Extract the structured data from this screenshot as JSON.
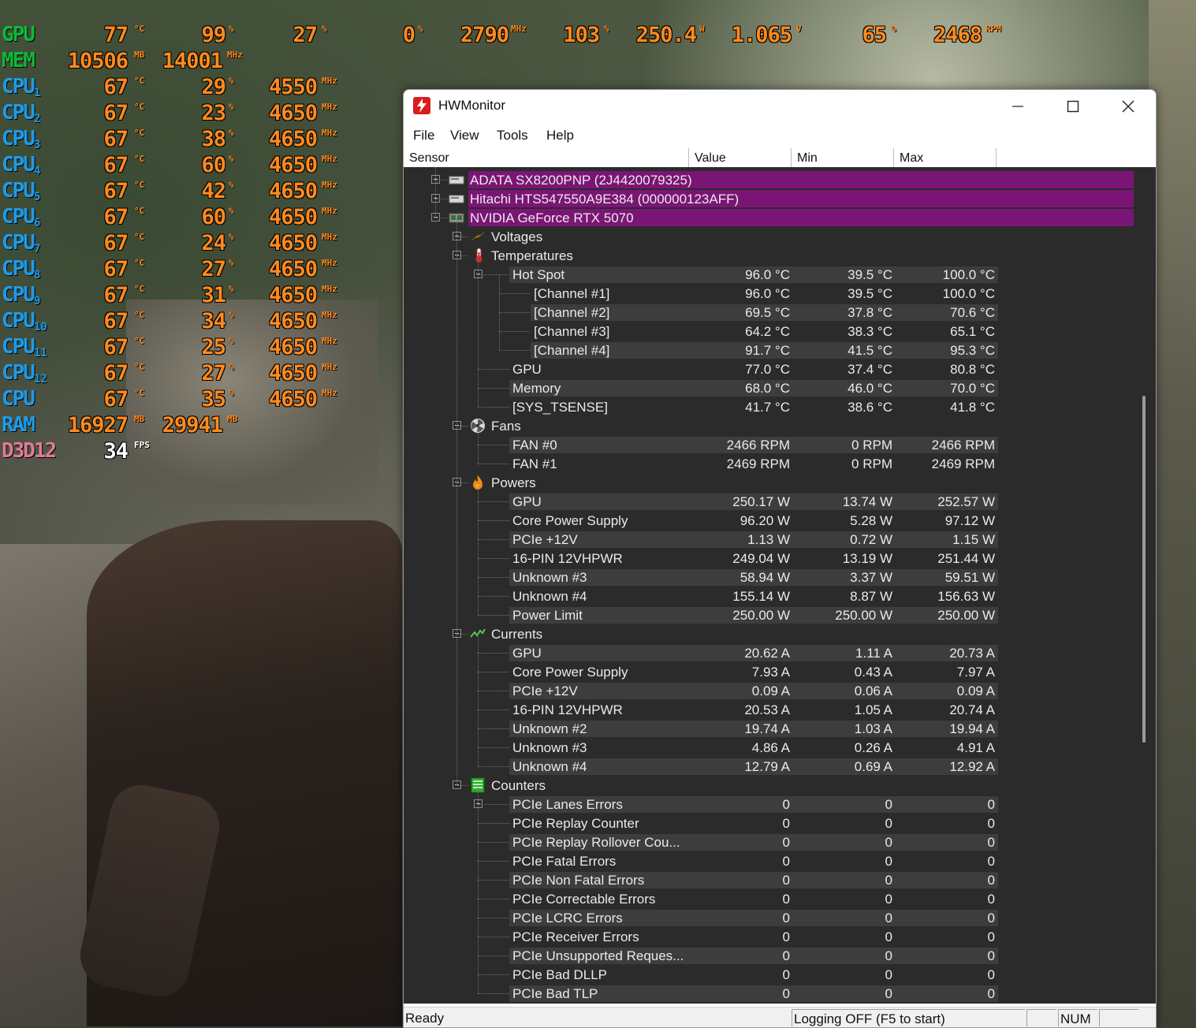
{
  "osd": {
    "gpu": {
      "label": "GPU",
      "temp": "77",
      "temp_unit": "°C",
      "load": "99",
      "load_unit": "%",
      "fan": "27",
      "fan_unit": "%",
      "v1": "0",
      "v1_unit": "%",
      "clock": "2790",
      "clock_unit": "MHz",
      "power_pct": "103",
      "power_pct_unit": "%",
      "power": "250.4",
      "power_unit": "W",
      "volt": "1.065",
      "volt_unit": "V",
      "fanpct": "65",
      "fanpct_unit": "%",
      "rpm": "2468",
      "rpm_unit": "RPM"
    },
    "mem": {
      "label": "MEM",
      "used": "10506",
      "used_unit": "MB",
      "clock": "14001",
      "clock_unit": "MHz"
    },
    "cpus": [
      {
        "label": "CPU",
        "sub": "1",
        "temp": "67",
        "load": "29",
        "clock": "4550"
      },
      {
        "label": "CPU",
        "sub": "2",
        "temp": "67",
        "load": "23",
        "clock": "4650"
      },
      {
        "label": "CPU",
        "sub": "3",
        "temp": "67",
        "load": "38",
        "clock": "4650"
      },
      {
        "label": "CPU",
        "sub": "4",
        "temp": "67",
        "load": "60",
        "clock": "4650"
      },
      {
        "label": "CPU",
        "sub": "5",
        "temp": "67",
        "load": "42",
        "clock": "4650"
      },
      {
        "label": "CPU",
        "sub": "6",
        "temp": "67",
        "load": "60",
        "clock": "4650"
      },
      {
        "label": "CPU",
        "sub": "7",
        "temp": "67",
        "load": "24",
        "clock": "4650"
      },
      {
        "label": "CPU",
        "sub": "8",
        "temp": "67",
        "load": "27",
        "clock": "4650"
      },
      {
        "label": "CPU",
        "sub": "9",
        "temp": "67",
        "load": "31",
        "clock": "4650"
      },
      {
        "label": "CPU",
        "sub": "10",
        "temp": "67",
        "load": "34",
        "clock": "4650"
      },
      {
        "label": "CPU",
        "sub": "11",
        "temp": "67",
        "load": "25",
        "clock": "4650"
      },
      {
        "label": "CPU",
        "sub": "12",
        "temp": "67",
        "load": "27",
        "clock": "4650"
      },
      {
        "label": "CPU",
        "sub": "",
        "temp": "67",
        "load": "35",
        "clock": "4650"
      }
    ],
    "cpu_units": {
      "temp": "°C",
      "load": "%",
      "clock": "MHz"
    },
    "ram": {
      "label": "RAM",
      "used": "16927",
      "used_unit": "MB",
      "total": "29941",
      "total_unit": "MB"
    },
    "fps": {
      "label": "D3D12",
      "value": "34",
      "unit": "FPS"
    }
  },
  "window": {
    "title": "HWMonitor",
    "menu": [
      "File",
      "View",
      "Tools",
      "Help"
    ],
    "columns": [
      "Sensor",
      "Value",
      "Min",
      "Max"
    ],
    "devices": [
      {
        "name": "ADATA SX8200PNP (2J4420079325)",
        "expanded": false
      },
      {
        "name": "Hitachi HTS547550A9E384 (000000123AFF)",
        "expanded": false
      },
      {
        "name": "NVIDIA GeForce RTX 5070",
        "expanded": true
      }
    ],
    "groups": {
      "voltages": "Voltages",
      "temperatures": "Temperatures",
      "fans": "Fans",
      "powers": "Powers",
      "currents": "Currents",
      "counters": "Counters"
    },
    "temperatures": [
      {
        "name": "Hot Spot",
        "value": "96.0 °C",
        "min": "39.5 °C",
        "max": "100.0 °C"
      },
      {
        "name": "[Channel #1]",
        "value": "96.0 °C",
        "min": "39.5 °C",
        "max": "100.0 °C"
      },
      {
        "name": "[Channel #2]",
        "value": "69.5 °C",
        "min": "37.8 °C",
        "max": "70.6 °C"
      },
      {
        "name": "[Channel #3]",
        "value": "64.2 °C",
        "min": "38.3 °C",
        "max": "65.1 °C"
      },
      {
        "name": "[Channel #4]",
        "value": "91.7 °C",
        "min": "41.5 °C",
        "max": "95.3 °C"
      },
      {
        "name": "GPU",
        "value": "77.0 °C",
        "min": "37.4 °C",
        "max": "80.8 °C"
      },
      {
        "name": "Memory",
        "value": "68.0 °C",
        "min": "46.0 °C",
        "max": "70.0 °C"
      },
      {
        "name": "[SYS_TSENSE]",
        "value": "41.7 °C",
        "min": "38.6 °C",
        "max": "41.8 °C"
      }
    ],
    "fans": [
      {
        "name": "FAN #0",
        "value": "2466 RPM",
        "min": "0 RPM",
        "max": "2466 RPM"
      },
      {
        "name": "FAN #1",
        "value": "2469 RPM",
        "min": "0 RPM",
        "max": "2469 RPM"
      }
    ],
    "powers": [
      {
        "name": "GPU",
        "value": "250.17 W",
        "min": "13.74 W",
        "max": "252.57 W"
      },
      {
        "name": "Core Power Supply",
        "value": "96.20 W",
        "min": "5.28 W",
        "max": "97.12 W"
      },
      {
        "name": "PCIe +12V",
        "value": "1.13 W",
        "min": "0.72 W",
        "max": "1.15 W"
      },
      {
        "name": "16-PIN 12VHPWR",
        "value": "249.04 W",
        "min": "13.19 W",
        "max": "251.44 W"
      },
      {
        "name": "Unknown #3",
        "value": "58.94 W",
        "min": "3.37 W",
        "max": "59.51 W"
      },
      {
        "name": "Unknown #4",
        "value": "155.14 W",
        "min": "8.87 W",
        "max": "156.63 W"
      },
      {
        "name": "Power Limit",
        "value": "250.00 W",
        "min": "250.00 W",
        "max": "250.00 W"
      }
    ],
    "currents": [
      {
        "name": "GPU",
        "value": "20.62 A",
        "min": "1.11 A",
        "max": "20.73 A"
      },
      {
        "name": "Core Power Supply",
        "value": "7.93 A",
        "min": "0.43 A",
        "max": "7.97 A"
      },
      {
        "name": "PCIe +12V",
        "value": "0.09 A",
        "min": "0.06 A",
        "max": "0.09 A"
      },
      {
        "name": "16-PIN 12VHPWR",
        "value": "20.53 A",
        "min": "1.05 A",
        "max": "20.74 A"
      },
      {
        "name": "Unknown #2",
        "value": "19.74 A",
        "min": "1.03 A",
        "max": "19.94 A"
      },
      {
        "name": "Unknown #3",
        "value": "4.86 A",
        "min": "0.26 A",
        "max": "4.91 A"
      },
      {
        "name": "Unknown #4",
        "value": "12.79 A",
        "min": "0.69 A",
        "max": "12.92 A"
      }
    ],
    "counters": [
      {
        "name": "PCIe Lanes Errors",
        "value": "0",
        "min": "0",
        "max": "0"
      },
      {
        "name": "PCIe Replay Counter",
        "value": "0",
        "min": "0",
        "max": "0"
      },
      {
        "name": "PCIe Replay Rollover Cou...",
        "value": "0",
        "min": "0",
        "max": "0"
      },
      {
        "name": "PCIe Fatal Errors",
        "value": "0",
        "min": "0",
        "max": "0"
      },
      {
        "name": "PCIe Non Fatal Errors",
        "value": "0",
        "min": "0",
        "max": "0"
      },
      {
        "name": "PCIe Correctable Errors",
        "value": "0",
        "min": "0",
        "max": "0"
      },
      {
        "name": "PCIe LCRC Errors",
        "value": "0",
        "min": "0",
        "max": "0"
      },
      {
        "name": "PCIe Receiver Errors",
        "value": "0",
        "min": "0",
        "max": "0"
      },
      {
        "name": "PCIe Unsupported Reques...",
        "value": "0",
        "min": "0",
        "max": "0"
      },
      {
        "name": "PCIe Bad DLLP",
        "value": "0",
        "min": "0",
        "max": "0"
      },
      {
        "name": "PCIe Bad TLP",
        "value": "0",
        "min": "0",
        "max": "0"
      }
    ],
    "status": {
      "ready": "Ready",
      "logging": "Logging OFF (F5 to start)",
      "num": "NUM"
    }
  },
  "colors": {
    "device_band": "#7b1575",
    "osd_value": "#ff8a1e",
    "osd_green": "#0fb83a",
    "osd_blue": "#1e9be8",
    "osd_pink": "#e07a96",
    "tree_bg": "#2b2b2b"
  }
}
